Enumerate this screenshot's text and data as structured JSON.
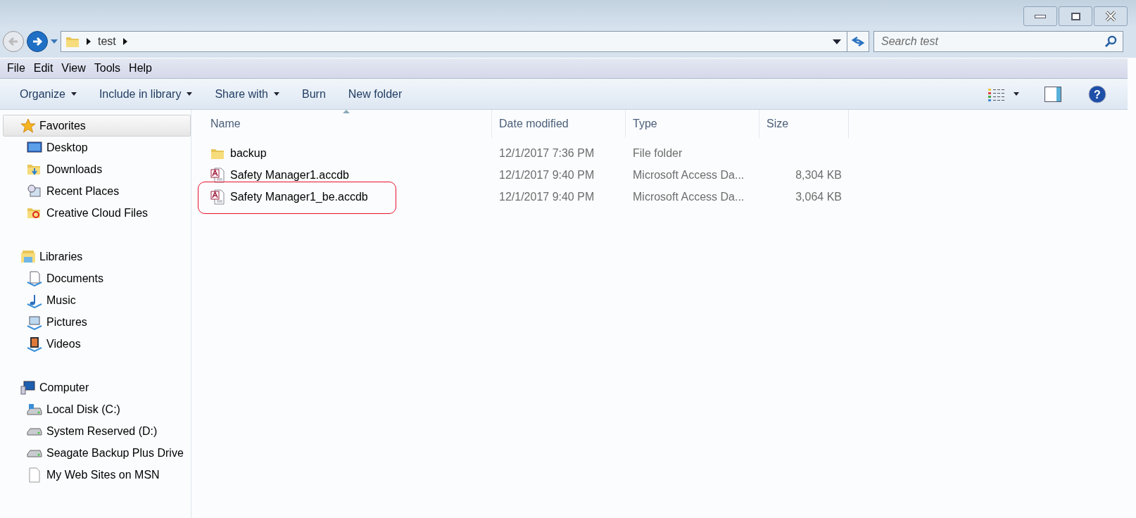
{
  "address_bar": {
    "path": [
      "test"
    ]
  },
  "search": {
    "placeholder": "Search test"
  },
  "menu_bar": [
    "File",
    "Edit",
    "View",
    "Tools",
    "Help"
  ],
  "toolbar": [
    {
      "label": "Organize",
      "dropdown": true
    },
    {
      "label": "Include in library",
      "dropdown": true
    },
    {
      "label": "Share with",
      "dropdown": true
    },
    {
      "label": "Burn",
      "dropdown": false
    },
    {
      "label": "New folder",
      "dropdown": false
    }
  ],
  "help_button": {
    "glyph": "?"
  },
  "sidebar": [
    {
      "label": "Favorites",
      "selected": true,
      "items": [
        "Desktop",
        "Downloads",
        "Recent Places",
        "Creative Cloud Files"
      ]
    },
    {
      "label": "Libraries",
      "selected": false,
      "items": [
        "Documents",
        "Music",
        "Pictures",
        "Videos"
      ]
    },
    {
      "label": "Computer",
      "selected": false,
      "items": [
        "Local Disk (C:)",
        "System Reserved (D:)",
        "Seagate Backup Plus Drive",
        "My Web Sites on MSN"
      ]
    }
  ],
  "table": {
    "columns": [
      "Name",
      "Date modified",
      "Type",
      "Size"
    ],
    "rows": [
      {
        "kind": "folder",
        "name": "backup",
        "date": "12/1/2017 7:36 PM",
        "type": "File folder",
        "circled": false
      },
      {
        "kind": "access",
        "name": "Safety Manager1.accdb",
        "date": "12/1/2017 9:40 PM",
        "type": "Microsoft Access Da...",
        "size": "8,304 KB",
        "circled": false
      },
      {
        "kind": "access",
        "name": "Safety Manager1_be.accdb",
        "date": "12/1/2017 9:40 PM",
        "type": "Microsoft Access Da...",
        "size": "3,064 KB",
        "circled": true
      }
    ]
  }
}
